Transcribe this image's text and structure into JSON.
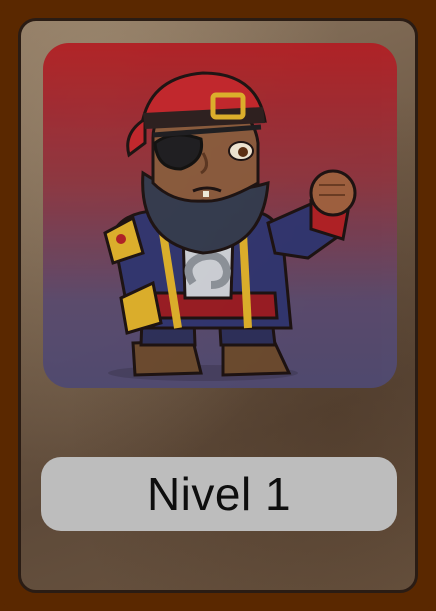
{
  "card": {
    "level_label": "Nivel 1",
    "character_icon": "pirate-captain-icon"
  },
  "colors": {
    "frame": "#5a2800",
    "portrait_top": "#b21f24",
    "portrait_bottom": "#4f4a72",
    "pill": "#bdbdbd"
  }
}
